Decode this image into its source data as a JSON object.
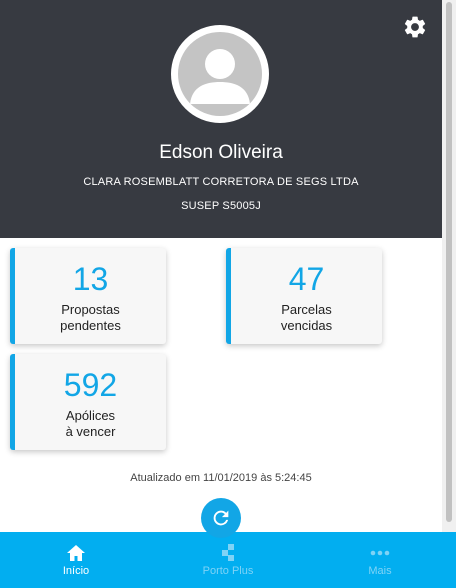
{
  "profile": {
    "name": "Edson Oliveira",
    "broker": "CLARA ROSEMBLATT CORRETORA DE SEGS LTDA",
    "susep": "SUSEP S5005J"
  },
  "cards": [
    {
      "value": "13",
      "line1": "Propostas",
      "line2": "pendentes"
    },
    {
      "value": "47",
      "line1": "Parcelas",
      "line2": "vencidas"
    },
    {
      "value": "592",
      "line1": "Apólices",
      "line2": "à vencer"
    }
  ],
  "updated": "Atualizado em 11/01/2019 às 5:24:45",
  "nav": [
    {
      "label": "Início",
      "icon": "home-icon"
    },
    {
      "label": "Porto Plus",
      "icon": "porto-plus-icon"
    },
    {
      "label": "Mais",
      "icon": "more-dots-icon"
    }
  ],
  "colors": {
    "header": "#373a41",
    "accent": "#12a6e6",
    "nav": "#02aef0"
  }
}
